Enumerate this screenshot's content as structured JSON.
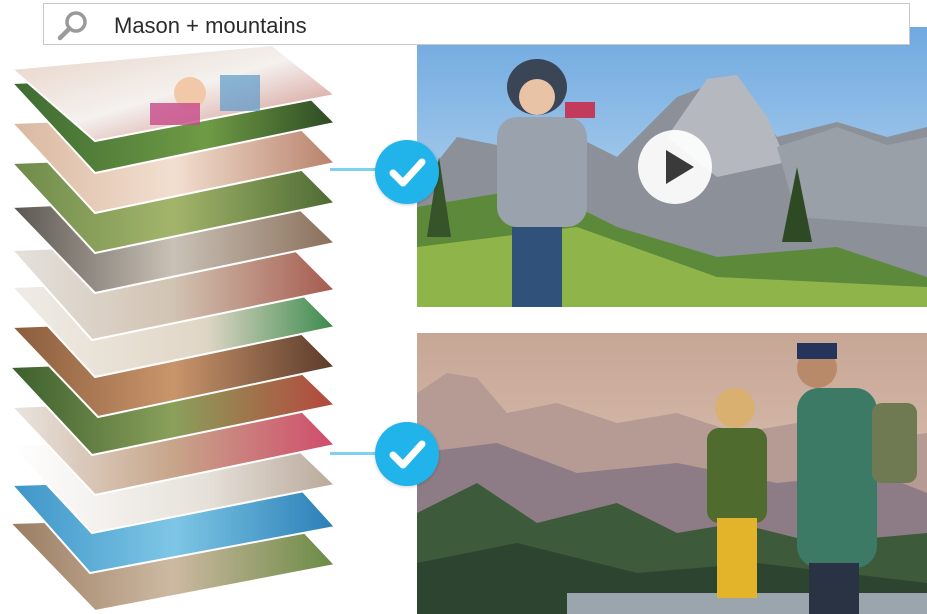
{
  "search": {
    "query": "Mason + mountains",
    "icon": "search-icon"
  },
  "colors": {
    "accent": "#21b4ea",
    "connector": "#7fd1ee",
    "search_border": "#c9c9c9"
  },
  "stack": {
    "photo_count": 13
  },
  "results": [
    {
      "type": "video",
      "matched": true,
      "icon": "play-icon"
    },
    {
      "type": "photo",
      "matched": true
    }
  ]
}
